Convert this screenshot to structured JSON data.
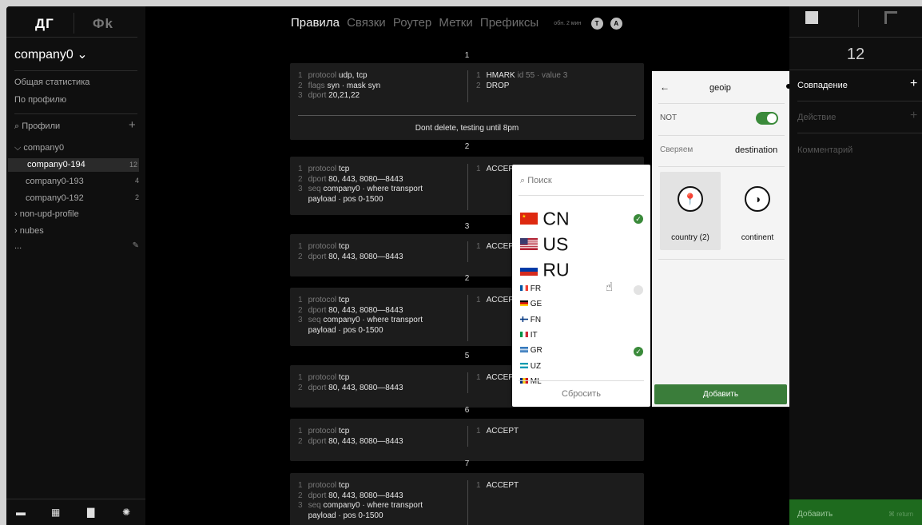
{
  "sidebar": {
    "logo_left": "ДГ",
    "logo_right": "Фk",
    "company": "company0 ⌄",
    "links": [
      "Общая статистика",
      "По профилю"
    ],
    "profiles_label": "Профили",
    "tree": [
      {
        "label": "⌵ company0",
        "count": ""
      },
      {
        "label": "company0-194",
        "count": "12"
      },
      {
        "label": "company0-193",
        "count": "4"
      },
      {
        "label": "company0-192",
        "count": "2"
      },
      {
        "label": "› non-upd-profile",
        "count": ""
      },
      {
        "label": "› nubes",
        "count": ""
      }
    ],
    "more": "..."
  },
  "tabs": [
    "Правила",
    "Связки",
    "Роутер",
    "Метки",
    "Префиксы"
  ],
  "update_label": "обн. 2 мин",
  "avatars": [
    "T",
    "A"
  ],
  "rules": [
    {
      "num": "1",
      "match": [
        [
          "1",
          "protocol ",
          "udp, tcp"
        ],
        [
          "2",
          "flags ",
          "syn · mask syn"
        ],
        [
          "3",
          "dport ",
          "20,21,22"
        ]
      ],
      "action": [
        [
          "1",
          "HMARK ",
          "id 55 · value 3"
        ],
        [
          "2",
          "",
          "DROP"
        ]
      ],
      "comment": "Dont delete, testing until 8pm"
    },
    {
      "num": "2",
      "match": [
        [
          "1",
          "protocol ",
          "tcp"
        ],
        [
          "2",
          "dport ",
          "80, 443, 8080—8443"
        ],
        [
          "3",
          "seq ",
          "company0 · where transport"
        ],
        [
          "",
          "",
          "payload · pos 0-1500"
        ]
      ],
      "action": [
        [
          "1",
          "",
          "ACCEPT"
        ]
      ]
    },
    {
      "num": "3",
      "match": [
        [
          "1",
          "protocol ",
          "tcp"
        ],
        [
          "2",
          "dport ",
          "80, 443, 8080—8443"
        ]
      ],
      "action": [
        [
          "1",
          "",
          "ACCEPT"
        ]
      ]
    },
    {
      "num": "2",
      "match": [
        [
          "1",
          "protocol ",
          "tcp"
        ],
        [
          "2",
          "dport ",
          "80, 443, 8080—8443"
        ],
        [
          "3",
          "seq ",
          "company0 · where transport"
        ],
        [
          "",
          "",
          "payload · pos 0-1500"
        ]
      ],
      "action": [
        [
          "1",
          "",
          "ACCEPT"
        ]
      ]
    },
    {
      "num": "5",
      "match": [
        [
          "1",
          "protocol ",
          "tcp"
        ],
        [
          "2",
          "dport ",
          "80, 443, 8080—8443"
        ]
      ],
      "action": [
        [
          "1",
          "",
          "ACCEPT"
        ]
      ]
    },
    {
      "num": "6",
      "match": [
        [
          "1",
          "protocol ",
          "tcp"
        ],
        [
          "2",
          "dport ",
          "80, 443, 8080—8443"
        ]
      ],
      "action": [
        [
          "1",
          "",
          "ACCEPT"
        ]
      ]
    },
    {
      "num": "7",
      "match": [
        [
          "1",
          "protocol ",
          "tcp"
        ],
        [
          "2",
          "dport ",
          "80, 443, 8080—8443"
        ],
        [
          "3",
          "seq ",
          "company0 · where transport"
        ],
        [
          "",
          "",
          "payload · pos 0-1500"
        ]
      ],
      "action": [
        [
          "1",
          "",
          "ACCEPT"
        ]
      ]
    }
  ],
  "country_popover": {
    "search_placeholder": "Поиск",
    "big": [
      {
        "code": "CN",
        "checked": true
      },
      {
        "code": "US",
        "checked": false
      },
      {
        "code": "RU",
        "checked": false
      }
    ],
    "small": [
      {
        "code": "FR",
        "checked": "hover"
      },
      {
        "code": "GE",
        "checked": false
      },
      {
        "code": "FN",
        "checked": false
      },
      {
        "code": "IT",
        "checked": false
      },
      {
        "code": "GR",
        "checked": true
      },
      {
        "code": "UZ",
        "checked": false
      },
      {
        "code": "ML",
        "checked": false
      }
    ],
    "reset": "Сбросить"
  },
  "geoip": {
    "back": "←",
    "title": "geoip",
    "not_label": "NOT",
    "compare_label": "Сверяем",
    "compare_value": "destination",
    "option_country": "country (2)",
    "option_continent": "continent",
    "add_button": "Добавить"
  },
  "right_panel": {
    "count": "12",
    "match": "Совпадение",
    "action": "Действие",
    "comment": "Комментарий",
    "add": "Добавить",
    "return_hint": "⌘ return"
  },
  "colors": {
    "accent_green": "#3a8a3a",
    "bg": "#000000",
    "card": "#1c1c1c"
  }
}
